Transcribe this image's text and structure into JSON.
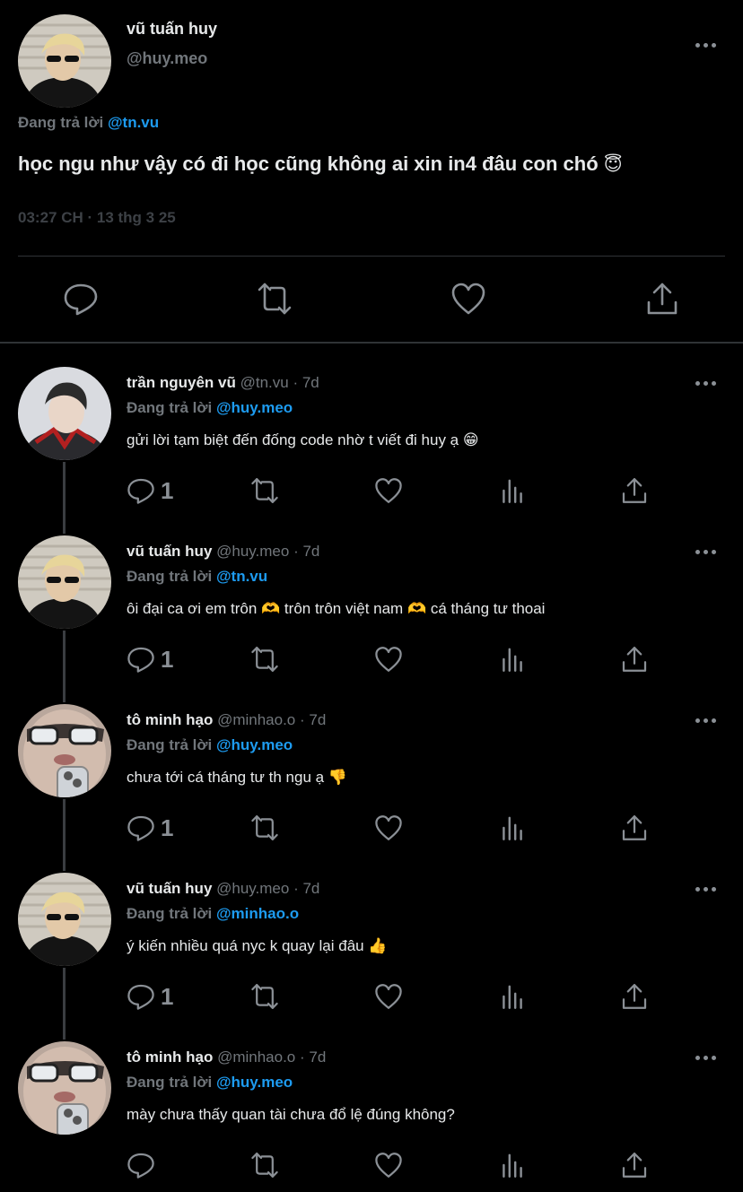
{
  "main_post": {
    "author_name": "vũ tuấn huy",
    "author_handle": "@huy.meo",
    "replying_label": "Đang trả lời",
    "replying_to": "@tn.vu",
    "text": "học ngu như vậy có đi học cũng không ai xin in4 đâu con chó",
    "text_emoji": "😇",
    "timestamp": "03:27 CH · 13 thg 3 25",
    "actions": [
      "reply-icon",
      "retweet-icon",
      "like-icon",
      "share-icon"
    ]
  },
  "replies": [
    {
      "name": "trần nguyên vũ",
      "handle": "@tn.vu",
      "age": "· 7d",
      "replying_label": "Đang trả lời",
      "replying_to": "@huy.meo",
      "text": "gửi lời tạm biệt đến đống code nhờ t viết đi huy ạ",
      "emoji": "😁",
      "reply_count": "1",
      "avatar": "avatar-tn-vu"
    },
    {
      "name": "vũ tuấn huy",
      "handle": "@huy.meo",
      "age": "· 7d",
      "replying_label": "Đang trả lời",
      "replying_to": "@tn.vu",
      "text": "ôi đại ca ơi em trôn 🫶 trôn trôn việt nam 🫶 cá tháng tư thoai",
      "emoji": "",
      "reply_count": "1",
      "avatar": "avatar-huy-meo"
    },
    {
      "name": "tô minh hạo",
      "handle": "@minhao.o",
      "age": "· 7d",
      "replying_label": "Đang trả lời",
      "replying_to": "@huy.meo",
      "text": "chưa tới cá tháng tư th ngu ạ",
      "emoji": "👎",
      "reply_count": "1",
      "avatar": "avatar-minhao"
    },
    {
      "name": "vũ tuấn huy",
      "handle": "@huy.meo",
      "age": "· 7d",
      "replying_label": "Đang trả lời",
      "replying_to": "@minhao.o",
      "text": "ý kiến nhiều quá nyc k quay lại đâu",
      "emoji": "👍",
      "reply_count": "1",
      "avatar": "avatar-huy-meo"
    },
    {
      "name": "tô minh hạo",
      "handle": "@minhao.o",
      "age": "· 7d",
      "replying_label": "Đang trả lời",
      "replying_to": "@huy.meo",
      "text": "mày chưa thấy quan tài chưa đổ lệ đúng không?",
      "emoji": "",
      "reply_count": "",
      "avatar": "avatar-minhao"
    }
  ],
  "colors": {
    "background": "#000000",
    "text": "#e7e9ea",
    "secondary": "#71767b",
    "mention": "#1d9bf0",
    "divider": "#2f3336"
  }
}
